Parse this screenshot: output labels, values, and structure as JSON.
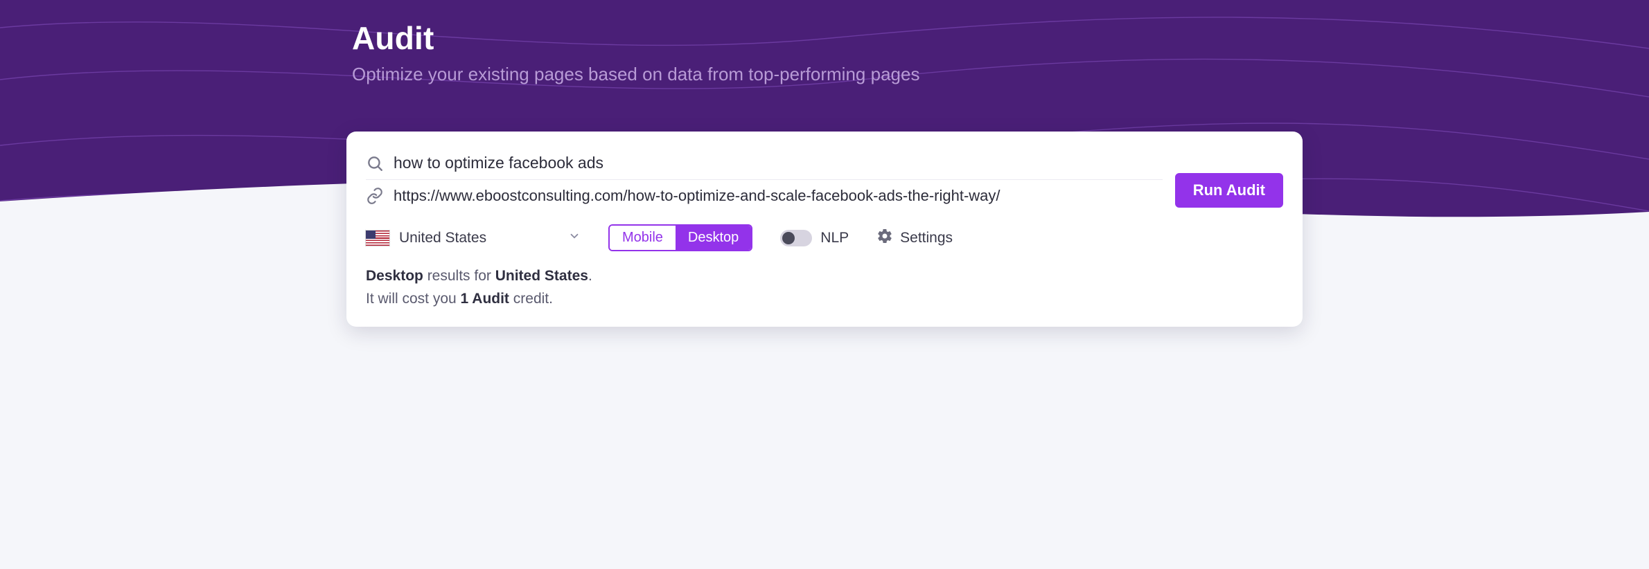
{
  "header": {
    "title": "Audit",
    "subtitle": "Optimize your existing pages based on data from top-performing pages"
  },
  "form": {
    "query_value": "how to optimize facebook ads",
    "url_value": "https://www.eboostconsulting.com/how-to-optimize-and-scale-facebook-ads-the-right-way/",
    "run_label": "Run Audit"
  },
  "options": {
    "country": "United States",
    "device": {
      "mobile_label": "Mobile",
      "desktop_label": "Desktop",
      "active": "Desktop"
    },
    "nlp": {
      "label": "NLP",
      "enabled": false
    },
    "settings_label": "Settings"
  },
  "summary": {
    "device": "Desktop",
    "mid1": " results for ",
    "country": "United States",
    "tail": ".",
    "cost_pre": "It will cost you ",
    "cost_bold": "1 Audit",
    "cost_post": " credit."
  },
  "colors": {
    "accent": "#9333ea",
    "hero": "#4a1f77"
  }
}
